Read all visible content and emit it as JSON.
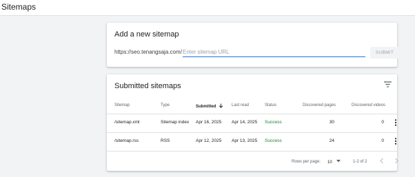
{
  "header": {
    "title": "Sitemaps"
  },
  "add_card": {
    "title": "Add a new sitemap",
    "url_prefix": "https://seo.tenangsaja.com/",
    "input_value": "",
    "input_placeholder": "Enter sitemap URL",
    "submit_label": "SUBMIT"
  },
  "submitted_card": {
    "title": "Submitted sitemaps",
    "columns": [
      "Sitemap",
      "Type",
      "Submitted",
      "Last read",
      "Status",
      "Discovered pages",
      "Discovered videos"
    ],
    "sort_column": "Submitted",
    "rows": [
      {
        "sitemap": "/sitemap.xml",
        "type": "Sitemap index",
        "submitted": "Apr 16, 2025",
        "last_read": "Apr 14, 2025",
        "status": "Success",
        "pages": "30",
        "videos": "0"
      },
      {
        "sitemap": "/sitemap.rss",
        "type": "RSS",
        "submitted": "Apr 12, 2025",
        "last_read": "Apr 13, 2025",
        "status": "Success",
        "pages": "24",
        "videos": "0"
      }
    ],
    "footer": {
      "rows_per_page_label": "Rows per page:",
      "rows_per_page_value": "10",
      "range_text": "1-2 of 2"
    }
  },
  "colors": {
    "accent": "#1a73e8",
    "success": "#188038"
  },
  "icons": [
    "filter-icon",
    "sort-down-arrow-icon",
    "more-vert-icon",
    "dropdown-arrow-icon",
    "chevron-left-icon",
    "chevron-right-icon"
  ]
}
